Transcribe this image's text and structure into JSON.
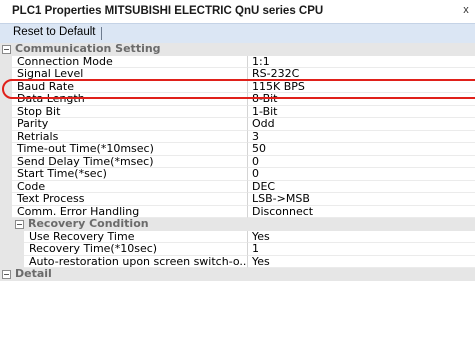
{
  "window": {
    "title": "PLC1 Properties MITSUBISHI ELECTRIC QnU series CPU",
    "close_glyph": "x"
  },
  "toolbar": {
    "reset_label": "Reset to Default"
  },
  "categories": {
    "communication": "Communication Setting",
    "recovery": "Recovery Condition",
    "detail": "Detail"
  },
  "communication": [
    {
      "name": "Connection Mode",
      "value": "1:1"
    },
    {
      "name": "Signal Level",
      "value": "RS-232C"
    },
    {
      "name": "Baud Rate",
      "value": "115K BPS"
    },
    {
      "name": "Data Length",
      "value": "8-Bit"
    },
    {
      "name": "Stop Bit",
      "value": "1-Bit"
    },
    {
      "name": "Parity",
      "value": "Odd"
    },
    {
      "name": "Retrials",
      "value": "3"
    },
    {
      "name": "Time-out Time(*10msec)",
      "value": "50"
    },
    {
      "name": "Send Delay Time(*msec)",
      "value": "0"
    },
    {
      "name": "Start Time(*sec)",
      "value": "0"
    },
    {
      "name": "Code",
      "value": "DEC"
    },
    {
      "name": "Text Process",
      "value": "LSB->MSB"
    },
    {
      "name": "Comm. Error Handling",
      "value": "Disconnect"
    }
  ],
  "recovery": [
    {
      "name": "Use Recovery Time",
      "value": "Yes"
    },
    {
      "name": "Recovery Time(*10sec)",
      "value": "1"
    },
    {
      "name": "Auto-restoration upon screen switch-o...",
      "value": "Yes"
    }
  ],
  "colors": {
    "highlight": "#e0201a",
    "toolbar": "#dbe6f4",
    "category": "#e6e6e6"
  }
}
